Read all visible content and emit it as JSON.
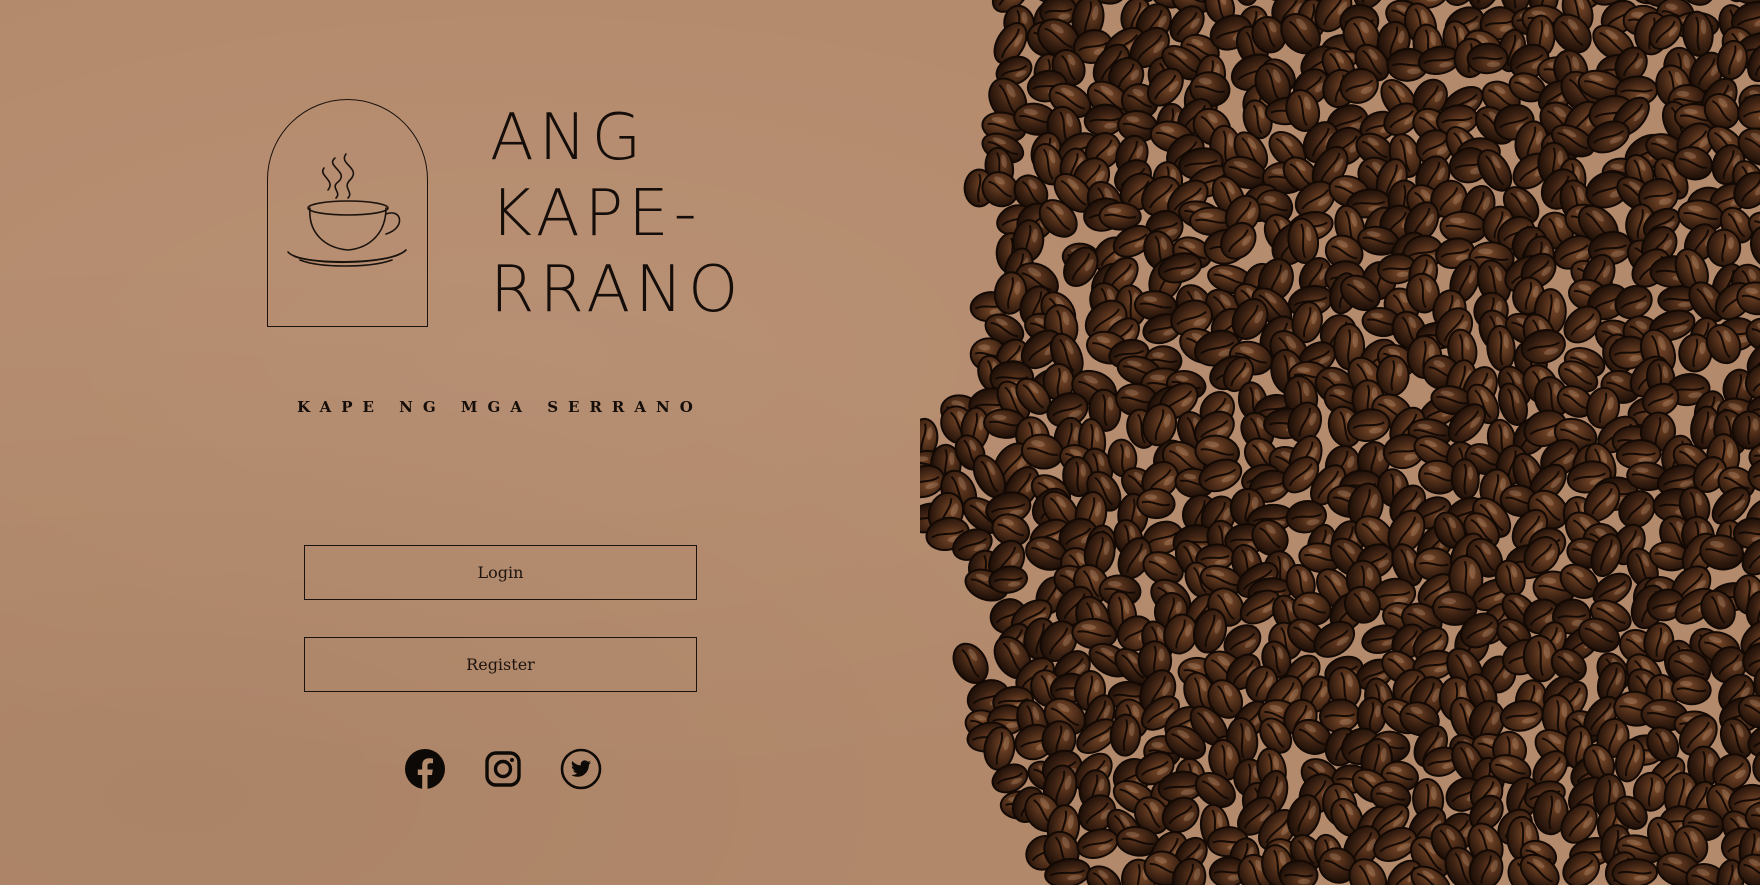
{
  "brand": {
    "title_lines": [
      "ANG",
      "KAPE-",
      "RRANO"
    ],
    "tagline": "KAPE NG MGA SERRANO"
  },
  "actions": {
    "login_label": "Login",
    "register_label": "Register"
  },
  "socials": [
    {
      "name": "facebook",
      "icon": "facebook-icon"
    },
    {
      "name": "instagram",
      "icon": "instagram-icon"
    },
    {
      "name": "twitter",
      "icon": "twitter-icon"
    }
  ],
  "colors": {
    "background": "#b48a6c",
    "ink": "#140d09",
    "bean_dark": "#2a170d",
    "bean_mid": "#4a2a17"
  },
  "images": {
    "hero": "coffee-beans-image",
    "logo": "coffee-cup-logo"
  }
}
